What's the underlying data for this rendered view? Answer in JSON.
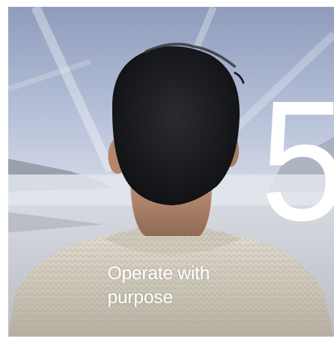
{
  "card": {
    "number": "5",
    "caption": "Operate with purpose"
  },
  "colors": {
    "sky_top": "#9aa6c3",
    "sky_mid": "#c9d2e4",
    "mist": "#dfe3ea",
    "hair": "#15161a",
    "skin": "#b98a70",
    "sweater": "#d8d2c4",
    "text": "#ffffff"
  }
}
